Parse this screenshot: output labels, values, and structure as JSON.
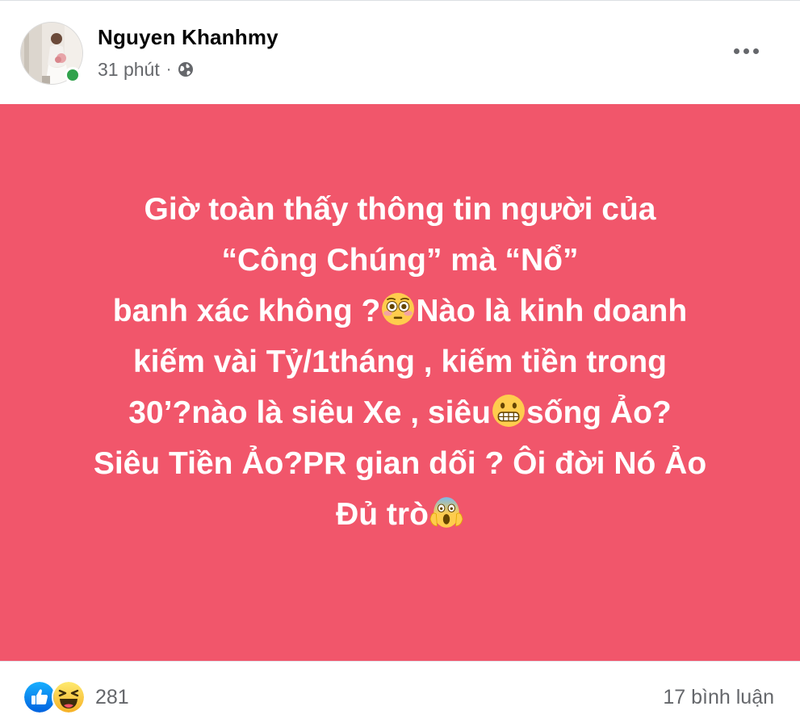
{
  "post": {
    "author": "Nguyen Khanhmy",
    "time": "31 phút",
    "separator": "·",
    "privacy_icon": "globe-icon",
    "more_icon": "more-options-icon",
    "background_color": "#f1566b",
    "text_lines": [
      {
        "segments": [
          "Giờ toàn thấy thông tin người của"
        ]
      },
      {
        "segments": [
          "“Công Chúng” mà “Nổ”"
        ]
      },
      {
        "segments": [
          "banh xác không ?",
          "Nào là kinh doanh"
        ],
        "emoji": "flushed-face-emoji"
      },
      {
        "segments": [
          "kiếm vài Tỷ/1tháng , kiếm tiền trong"
        ]
      },
      {
        "segments": [
          "30’?nào là siêu Xe , siêu",
          "sống Ảo?"
        ],
        "emoji": "grimacing-face-emoji"
      },
      {
        "segments": [
          "Siêu Tiền Ảo?PR gian dối ? Ôi đời Nó Ảo"
        ]
      },
      {
        "segments": [
          "Đủ trò",
          ""
        ],
        "emoji": "screaming-face-emoji"
      }
    ]
  },
  "footer": {
    "reactions": [
      "like-reaction-icon",
      "haha-reaction-icon"
    ],
    "reaction_count": "281",
    "comments": "17 bình luận"
  },
  "colors": {
    "like_blue": "#1877f2",
    "haha_yellow": "#f7b125",
    "online_green": "#31a24c"
  }
}
